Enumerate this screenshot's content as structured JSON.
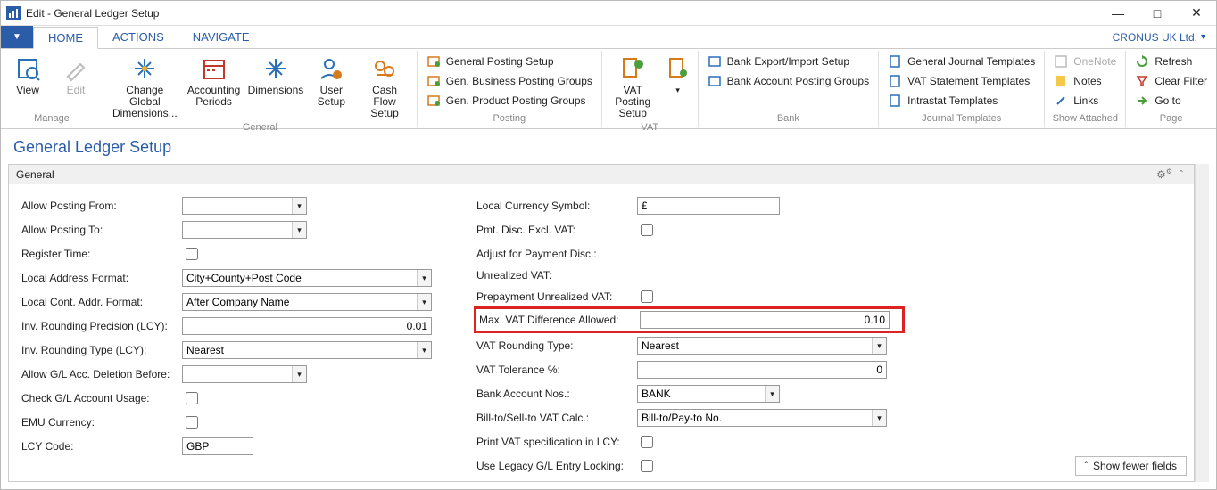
{
  "window": {
    "title": "Edit - General Ledger Setup",
    "company": "CRONUS UK Ltd."
  },
  "tabs": {
    "home": "HOME",
    "actions": "ACTIONS",
    "navigate": "NAVIGATE"
  },
  "ribbon": {
    "manage": {
      "label": "Manage",
      "view": "View",
      "edit": "Edit"
    },
    "general": {
      "label": "General",
      "changeGlobal": "Change Global\nDimensions...",
      "accountingPeriods": "Accounting\nPeriods",
      "dimensions": "Dimensions",
      "userSetup": "User\nSetup",
      "cashFlow": "Cash Flow\nSetup"
    },
    "posting": {
      "label": "Posting",
      "generalPostingSetup": "General Posting Setup",
      "genBusiness": "Gen. Business Posting Groups",
      "genProduct": "Gen. Product Posting Groups",
      "vatPosting": "VAT Posting\nSetup"
    },
    "vat": {
      "label": "VAT"
    },
    "bank": {
      "label": "Bank",
      "bankExport": "Bank Export/Import Setup",
      "bankAccount": "Bank Account Posting Groups"
    },
    "journal": {
      "label": "Journal Templates",
      "generalJournal": "General Journal Templates",
      "vatStatement": "VAT Statement Templates",
      "intrastat": "Intrastat Templates"
    },
    "showAttached": {
      "label": "Show Attached",
      "onenote": "OneNote",
      "notes": "Notes",
      "links": "Links"
    },
    "page": {
      "label": "Page",
      "refresh": "Refresh",
      "clearFilter": "Clear Filter",
      "goto": "Go to"
    }
  },
  "page_title": "General Ledger Setup",
  "panel": {
    "header": "General",
    "showFewer": "Show fewer fields"
  },
  "left": {
    "allowPostingFrom": {
      "label": "Allow Posting From:",
      "value": ""
    },
    "allowPostingTo": {
      "label": "Allow Posting To:",
      "value": ""
    },
    "registerTime": {
      "label": "Register Time:"
    },
    "localAddrFormat": {
      "label": "Local Address Format:",
      "value": "City+County+Post Code"
    },
    "localContAddrFormat": {
      "label": "Local Cont. Addr. Format:",
      "value": "After Company Name"
    },
    "invRoundingPrecision": {
      "label": "Inv. Rounding Precision (LCY):",
      "value": "0.01"
    },
    "invRoundingType": {
      "label": "Inv. Rounding Type (LCY):",
      "value": "Nearest"
    },
    "allowGLDeletion": {
      "label": "Allow G/L Acc. Deletion Before:",
      "value": ""
    },
    "checkGLUsage": {
      "label": "Check G/L Account Usage:"
    },
    "emuCurrency": {
      "label": "EMU Currency:"
    },
    "lcyCode": {
      "label": "LCY Code:",
      "value": "GBP"
    }
  },
  "right": {
    "localCurrencySymbol": {
      "label": "Local Currency Symbol:",
      "value": "£"
    },
    "pmtDiscExclVAT": {
      "label": "Pmt. Disc. Excl. VAT:"
    },
    "adjustPaymentDisc": {
      "label": "Adjust for Payment Disc.:"
    },
    "unrealizedVAT": {
      "label": "Unrealized VAT:"
    },
    "prepaymentUnrealizedVAT": {
      "label": "Prepayment Unrealized VAT:"
    },
    "maxVATDiff": {
      "label": "Max. VAT Difference Allowed:",
      "value": "0.10"
    },
    "vatRoundingType": {
      "label": "VAT Rounding Type:",
      "value": "Nearest"
    },
    "vatTolerance": {
      "label": "VAT Tolerance %:",
      "value": "0"
    },
    "bankAccountNos": {
      "label": "Bank Account Nos.:",
      "value": "BANK"
    },
    "billToVATCalc": {
      "label": "Bill-to/Sell-to VAT Calc.:",
      "value": "Bill-to/Pay-to No."
    },
    "printVATSpec": {
      "label": "Print VAT specification in LCY:"
    },
    "useLegacyGL": {
      "label": "Use Legacy G/L Entry Locking:"
    }
  }
}
